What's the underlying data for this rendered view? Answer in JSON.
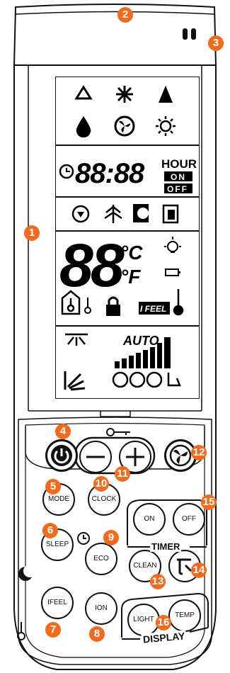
{
  "callouts": [
    "1",
    "2",
    "3",
    "4",
    "5",
    "6",
    "7",
    "8",
    "9",
    "10",
    "11",
    "12",
    "13",
    "14",
    "15",
    "16"
  ],
  "display": {
    "time_digits": "88:88",
    "hour": "HOUR",
    "on": "ON",
    "off": "OFF",
    "temp_digits": "88",
    "celsius": "°C",
    "fahrenheit": "°F",
    "ifeel": "I FEEL",
    "auto": "AUTO"
  },
  "buttons": {
    "mode": "MODE",
    "clock": "CLOCK",
    "on": "ON",
    "off": "OFF",
    "sleep": "SLEEP",
    "eco": "ECO",
    "clean": "CLEAN",
    "ifeel": "IFEEL",
    "ion": "ION",
    "light": "LIGHT",
    "temp": "TEMP"
  },
  "groups": {
    "timer": "TIMER",
    "display": "DISPLAY"
  },
  "colors": {
    "callout": "#f26b1d",
    "body": "#ffffff",
    "outline": "#111111"
  }
}
